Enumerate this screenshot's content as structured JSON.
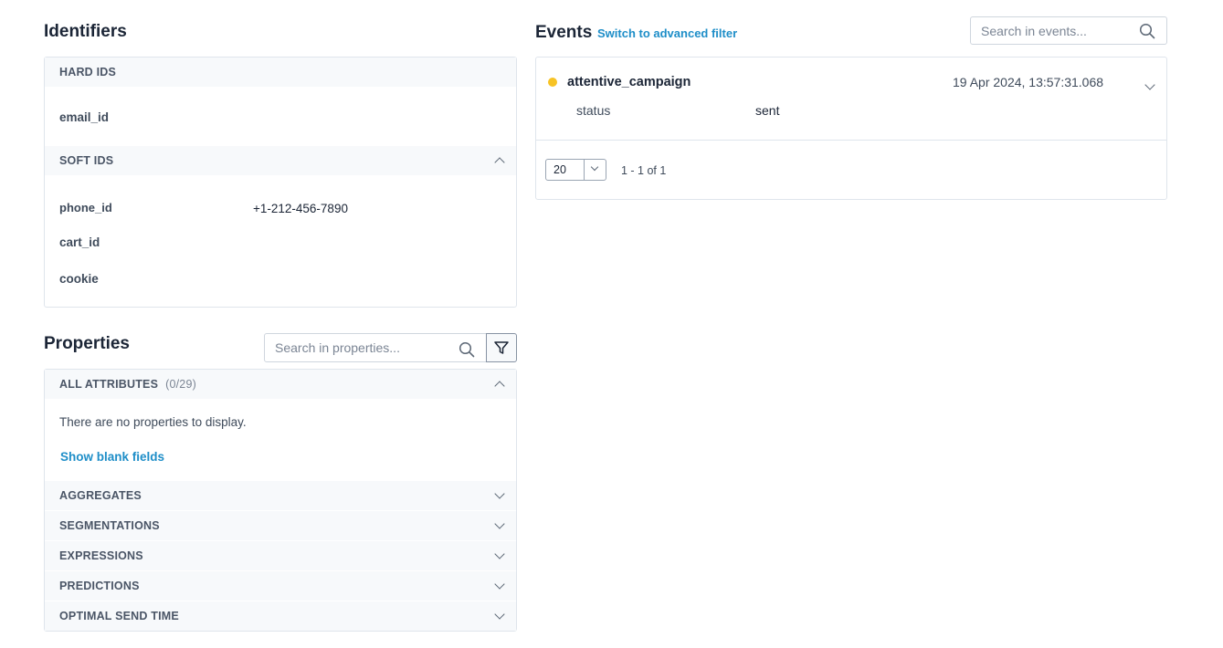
{
  "identifiers": {
    "title": "Identifiers",
    "hard_ids": {
      "header": "HARD IDS",
      "items": [
        {
          "key": "email_id",
          "value": ""
        }
      ]
    },
    "soft_ids": {
      "header": "SOFT IDS",
      "items": [
        {
          "key": "phone_id",
          "value": "+1-212-456-7890"
        },
        {
          "key": "cart_id",
          "value": ""
        },
        {
          "key": "cookie",
          "value": ""
        }
      ]
    }
  },
  "properties": {
    "title": "Properties",
    "search_placeholder": "Search in properties...",
    "all_attributes": {
      "header": "ALL ATTRIBUTES",
      "count": "(0/29)",
      "empty_text": "There are no properties to display.",
      "show_blank_label": "Show blank fields"
    },
    "groups": [
      {
        "label": "AGGREGATES"
      },
      {
        "label": "SEGMENTATIONS"
      },
      {
        "label": "EXPRESSIONS"
      },
      {
        "label": "PREDICTIONS"
      },
      {
        "label": "OPTIMAL SEND TIME"
      }
    ]
  },
  "events": {
    "title": "Events",
    "switch_filter_label": "Switch to advanced filter",
    "search_placeholder": "Search in events...",
    "items": [
      {
        "name": "attentive_campaign",
        "timestamp": "19 Apr 2024, 13:57:31.068",
        "status_color": "#f7c325",
        "properties": [
          {
            "key": "status",
            "value": "sent"
          }
        ]
      }
    ],
    "pagination": {
      "page_size": "20",
      "range_text": "1 - 1 of 1"
    }
  },
  "colors": {
    "accent_link": "#1e8ec8",
    "event_dot": "#f7c325"
  }
}
